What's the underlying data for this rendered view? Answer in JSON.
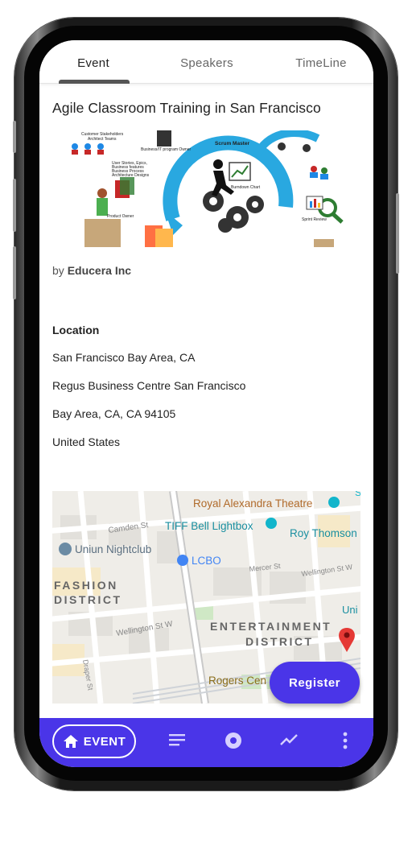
{
  "tabs": [
    {
      "label": "Event",
      "active": true
    },
    {
      "label": "Speakers",
      "active": false
    },
    {
      "label": "TimeLine",
      "active": false
    }
  ],
  "event": {
    "title": "Agile Classroom Training in San Francisco",
    "banner": {
      "labels": {
        "customer_stakeholders": "Customer Stakeholders",
        "architect_teams": "Architect Teams",
        "business_it_owner": "Business/IT program Owner",
        "scrum_master": "Scrum Master",
        "user_stories_1": "User Stories, Epics,",
        "user_stories_2": "Business features",
        "user_stories_3": "Business Process",
        "user_stories_4": "Architecture Designs",
        "burndown": "Burndown Chart",
        "product_owner": "Product Owner",
        "sprint_review": "Sprint Review"
      }
    },
    "by_prefix": "by",
    "organizer": "Educera Inc",
    "location_heading": "Location",
    "location_lines": [
      "San Francisco Bay Area, CA",
      "Regus Business Centre San Francisco",
      "Bay Area, CA, CA 94105",
      "United States"
    ]
  },
  "map": {
    "labels": {
      "royal_alexandra": "Royal Alexandra Theatre",
      "camden": "Camden St",
      "tiff": "TIFF Bell Lightbox",
      "roy_thomson": "Roy Thomson",
      "uniun": "Uniun Nightclub",
      "lcbo": "LCBO",
      "mercer": "Mercer St",
      "wellington_right": "Wellington St W",
      "fashion_1": "FASHION",
      "fashion_2": "DISTRICT",
      "wellington": "Wellington St W",
      "entertainment_1": "ENTERTAINMENT",
      "entertainment_2": "DISTRICT",
      "draper": "Draper St",
      "rogers": "Rogers Cen",
      "uni": "Uni",
      "s_top": "S"
    }
  },
  "actions": {
    "register_label": "Register"
  },
  "bottom_nav": {
    "event_label": "EVENT",
    "icons": [
      "home-icon",
      "notes-icon",
      "record-icon",
      "trending-icon",
      "more-vert-icon"
    ]
  },
  "colors": {
    "accent": "#4a35e8",
    "map_pin": "#e53935",
    "poi_blue": "#4285f4",
    "poi_teal": "#12b5cb"
  }
}
